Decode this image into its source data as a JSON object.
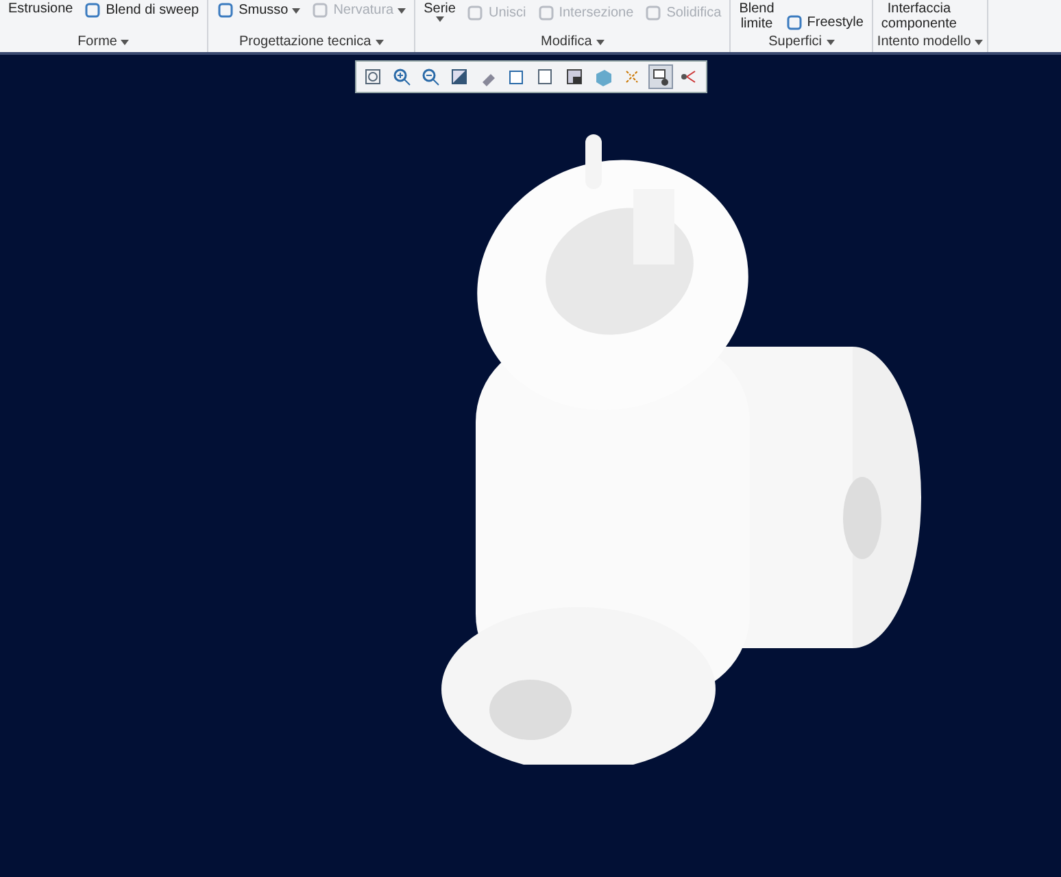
{
  "ribbon": {
    "groups": [
      {
        "label": "Forme",
        "commands": [
          {
            "kind": "text",
            "label": "Estrusione",
            "disabled": false
          },
          {
            "kind": "icon",
            "label": "Blend di sweep",
            "disabled": false
          }
        ]
      },
      {
        "label": "Progettazione tecnica",
        "commands": [
          {
            "kind": "dropdown",
            "label": "Smusso",
            "disabled": false
          },
          {
            "kind": "dropdown",
            "label": "Nervatura",
            "disabled": true
          }
        ]
      },
      {
        "label": "Modifica",
        "commands": [
          {
            "kind": "stacked",
            "label": "Serie",
            "disabled": false
          },
          {
            "kind": "icon",
            "label": "Unisci",
            "disabled": true
          },
          {
            "kind": "icon",
            "label": "Intersezione",
            "disabled": true
          },
          {
            "kind": "icon",
            "label": "Solidifica",
            "disabled": true
          }
        ]
      },
      {
        "label": "Superfici",
        "commands": [
          {
            "kind": "twoline",
            "label": "Blend",
            "label2": "limite",
            "disabled": false
          },
          {
            "kind": "icon",
            "label": "Freestyle",
            "disabled": false
          }
        ]
      },
      {
        "label": "Intento modello",
        "commands": [
          {
            "kind": "twoline",
            "label": "Interfaccia",
            "label2": "componente",
            "disabled": false
          }
        ]
      }
    ]
  },
  "view_toolbar": [
    {
      "selected": false
    },
    {
      "selected": false
    },
    {
      "selected": false
    },
    {
      "selected": false
    },
    {
      "selected": false
    },
    {
      "selected": false
    },
    {
      "selected": false
    },
    {
      "selected": false
    },
    {
      "selected": false
    },
    {
      "selected": false
    },
    {
      "selected": true
    },
    {
      "selected": false
    }
  ]
}
